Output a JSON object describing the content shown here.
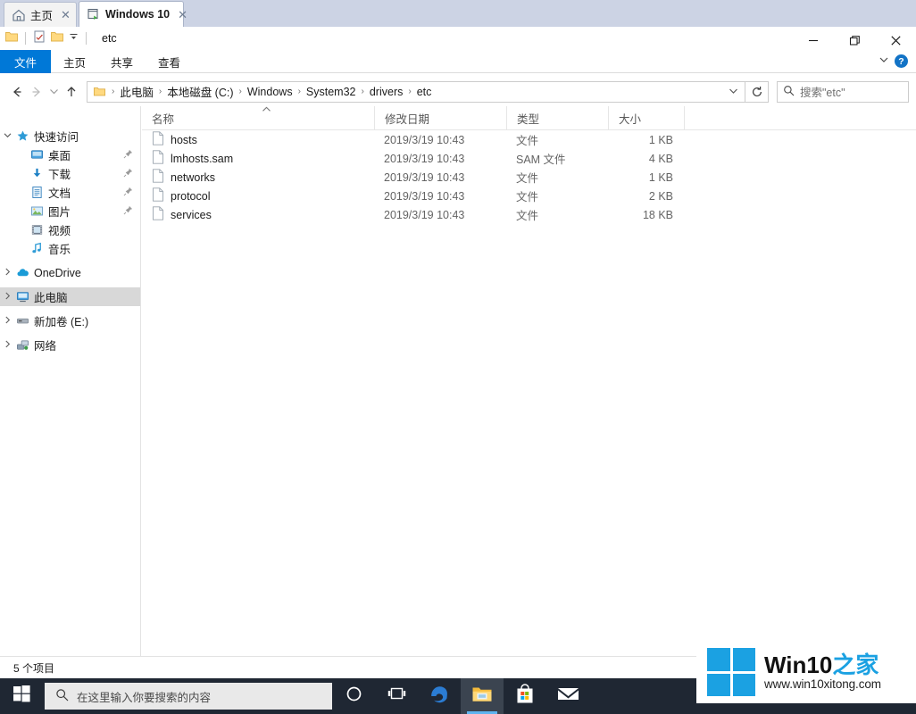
{
  "window": {
    "tabs": [
      {
        "label": "主页",
        "icon": "home-icon",
        "active": false,
        "close": "✕"
      },
      {
        "label": "Windows 10",
        "icon": "explorer-tab-icon",
        "active": true,
        "close": "✕"
      }
    ],
    "quick_access_title": "etc",
    "controls": {
      "minimize": "minimize-icon",
      "maximize": "maximize-icon",
      "close": "close-icon"
    },
    "ribbon_collapse": "chevron-down-icon",
    "help": "?"
  },
  "ribbon": {
    "file_tab": "文件",
    "tabs": [
      "主页",
      "共享",
      "查看"
    ]
  },
  "address": {
    "back": "←",
    "forward": "→",
    "recent": "⌄",
    "up": "↑",
    "breadcrumbs": [
      "此电脑",
      "本地磁盘 (C:)",
      "Windows",
      "System32",
      "drivers",
      "etc"
    ],
    "separator": "›",
    "dropdown": "⌄",
    "refresh": "↻",
    "refresh_name": "refresh-icon"
  },
  "search": {
    "icon": "search-icon",
    "placeholder": "搜索\"etc\""
  },
  "sidebar": {
    "items": [
      {
        "label": "快速访问",
        "icon": "star-icon",
        "chevron": "open",
        "indent": 0,
        "pin": "",
        "selected": false
      },
      {
        "label": "桌面",
        "icon": "desktop-icon",
        "chevron": "none",
        "indent": 1,
        "pin": "📌",
        "selected": false
      },
      {
        "label": "下载",
        "icon": "download-icon",
        "chevron": "none",
        "indent": 1,
        "pin": "📌",
        "selected": false
      },
      {
        "label": "文档",
        "icon": "documents-icon",
        "chevron": "none",
        "indent": 1,
        "pin": "📌",
        "selected": false
      },
      {
        "label": "图片",
        "icon": "pictures-icon",
        "chevron": "none",
        "indent": 1,
        "pin": "📌",
        "selected": false
      },
      {
        "label": "视频",
        "icon": "videos-icon",
        "chevron": "none",
        "indent": 1,
        "pin": "",
        "selected": false
      },
      {
        "label": "音乐",
        "icon": "music-icon",
        "chevron": "none",
        "indent": 1,
        "pin": "",
        "selected": false
      },
      {
        "label": "OneDrive",
        "icon": "onedrive-icon",
        "chevron": "closed",
        "indent": 0,
        "pin": "",
        "selected": false
      },
      {
        "label": "此电脑",
        "icon": "this-pc-icon",
        "chevron": "closed",
        "indent": 0,
        "pin": "",
        "selected": true
      },
      {
        "label": "新加卷 (E:)",
        "icon": "drive-icon",
        "chevron": "closed",
        "indent": 0,
        "pin": "",
        "selected": false
      },
      {
        "label": "网络",
        "icon": "network-icon",
        "chevron": "closed",
        "indent": 0,
        "pin": "",
        "selected": false
      }
    ]
  },
  "filelist": {
    "columns": [
      {
        "label": "名称",
        "key": "name"
      },
      {
        "label": "修改日期",
        "key": "date"
      },
      {
        "label": "类型",
        "key": "type"
      },
      {
        "label": "大小",
        "key": "size"
      }
    ],
    "sort_indicator": "⌃",
    "rows": [
      {
        "name": "hosts",
        "date": "2019/3/19 10:43",
        "type": "文件",
        "size": "1 KB",
        "icon": "file-icon"
      },
      {
        "name": "lmhosts.sam",
        "date": "2019/3/19 10:43",
        "type": "SAM 文件",
        "size": "4 KB",
        "icon": "file-icon"
      },
      {
        "name": "networks",
        "date": "2019/3/19 10:43",
        "type": "文件",
        "size": "1 KB",
        "icon": "file-icon"
      },
      {
        "name": "protocol",
        "date": "2019/3/19 10:43",
        "type": "文件",
        "size": "2 KB",
        "icon": "file-icon"
      },
      {
        "name": "services",
        "date": "2019/3/19 10:43",
        "type": "文件",
        "size": "18 KB",
        "icon": "file-icon"
      }
    ]
  },
  "statusbar": {
    "item_count": "5 个项目"
  },
  "taskbar": {
    "start": "start-icon",
    "search_placeholder": "在这里输入你要搜索的内容",
    "search_icon": "search-icon",
    "buttons": [
      {
        "name": "cortana-icon"
      },
      {
        "name": "task-view-icon"
      },
      {
        "name": "edge-icon"
      },
      {
        "name": "file-explorer-icon"
      },
      {
        "name": "microsoft-store-icon"
      },
      {
        "name": "mail-icon"
      }
    ],
    "tray_expand": "⌃"
  },
  "watermark": {
    "title_black": "Win10",
    "title_blue": "之家",
    "url": "www.win10xitong.com"
  },
  "colors": {
    "accent": "#0078d7",
    "tabstrip": "#ccd3e4",
    "taskbar": "#1f2733",
    "watermark_blue": "#1ba1e2",
    "selection": "#d8d8d8"
  }
}
